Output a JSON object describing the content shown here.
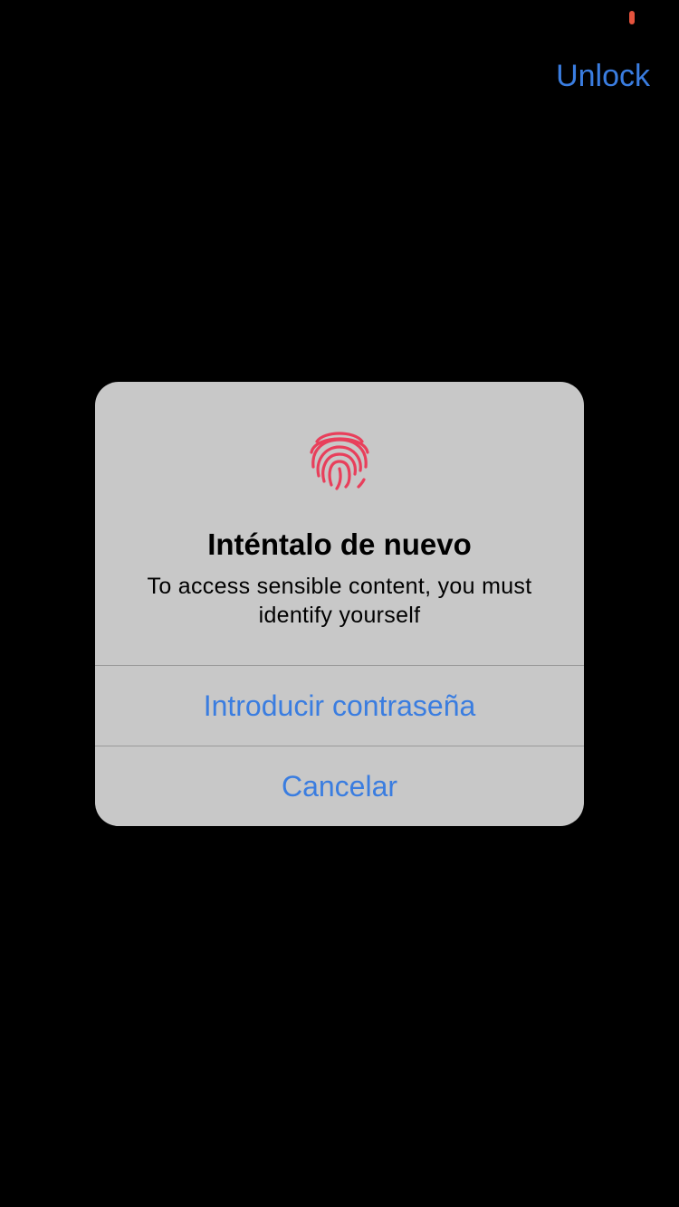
{
  "colors": {
    "accent": "#3a7de0",
    "status_indicator": "#e5533d",
    "fingerprint": "#e83f5b",
    "alert_background": "#c8c8c8",
    "background": "#000000"
  },
  "header": {
    "unlock_label": "Unlock"
  },
  "alert": {
    "icon": "fingerprint-icon",
    "title": "Inténtalo de nuevo",
    "message": "To access sensible content, you must identify yourself",
    "buttons": [
      {
        "label": "Introducir contraseña"
      },
      {
        "label": "Cancelar"
      }
    ]
  }
}
